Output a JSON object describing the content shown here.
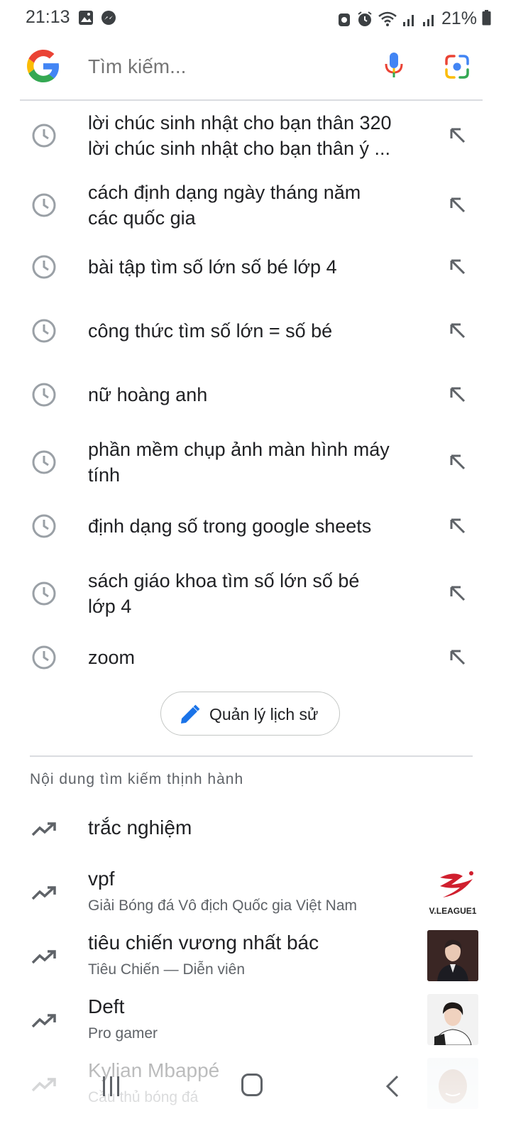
{
  "status_bar": {
    "time": "21:13",
    "battery": "21%",
    "left_icons": [
      "gallery-icon",
      "messenger-icon"
    ],
    "right_icons": [
      "notification-lock-icon",
      "alarm-icon",
      "wifi-icon",
      "signal-icon",
      "signal-icon",
      "battery-icon"
    ]
  },
  "search": {
    "placeholder": "Tìm kiếm...",
    "value": "",
    "colors": {
      "blue": "#4285F4",
      "red": "#EA4335",
      "yellow": "#FBBC05",
      "green": "#34A853"
    }
  },
  "history": [
    {
      "lines": [
        "lời chúc sinh nhật cho bạn thân 320",
        "lời chúc sinh nhật cho bạn thân ý ..."
      ]
    },
    {
      "lines": [
        "cách định dạng ngày tháng năm",
        "các quốc gia"
      ]
    },
    {
      "lines": [
        "bài tập tìm số lớn số bé lớp 4"
      ]
    },
    {
      "lines": [
        "công thức tìm số lớn = số bé"
      ]
    },
    {
      "lines": [
        "nữ hoàng anh"
      ]
    },
    {
      "lines": [
        "phần mềm chụp ảnh màn hình máy",
        "tính"
      ]
    },
    {
      "lines": [
        "định dạng số trong google sheets"
      ]
    },
    {
      "lines": [
        "sách giáo khoa tìm số lớn số bé",
        "lớp 4"
      ]
    },
    {
      "lines": [
        "zoom"
      ]
    }
  ],
  "manage_history": {
    "label": "Quản lý lịch sử"
  },
  "trending": {
    "title": "Nội dung tìm kiếm thịnh hành",
    "items": [
      {
        "title": "trắc nghiệm",
        "subtitle": "",
        "thumb": ""
      },
      {
        "title": "vpf",
        "subtitle": "Giải Bóng đá Vô địch Quốc gia Việt Nam",
        "thumb": "vleague",
        "thumb_text": "V.LEAGUE1"
      },
      {
        "title": "tiêu chiến vương nhất bác",
        "subtitle": "Tiêu Chiến — Diễn viên",
        "thumb": "person-suit"
      },
      {
        "title": "Deft",
        "subtitle": "Pro gamer",
        "thumb": "person-jersey"
      },
      {
        "title": "Kylian Mbappé",
        "subtitle": "Cầu thủ bóng đá",
        "thumb": "person-face"
      }
    ]
  },
  "nav": {
    "icons": [
      "recent-apps-icon",
      "home-icon",
      "back-icon"
    ]
  }
}
